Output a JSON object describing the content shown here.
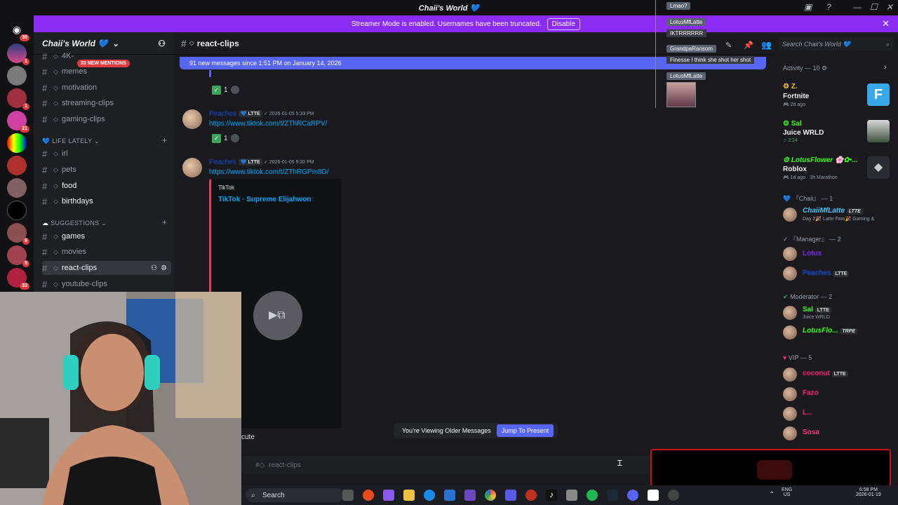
{
  "window": {
    "title": "Chaii's World 💙"
  },
  "banner": {
    "text": "Streamer Mode is enabled. Usernames have been truncated.",
    "disable_label": "Disable"
  },
  "rail": {
    "badges": [
      "30",
      "1",
      "1",
      "21",
      "6",
      "8",
      "5",
      "33"
    ]
  },
  "server": {
    "name": "Chaii's World 💙"
  },
  "mentions_pill": "33 NEW MENTIONS",
  "channels_top": [
    {
      "label": "4K-"
    },
    {
      "label": "memes"
    },
    {
      "label": "motivation"
    },
    {
      "label": "streaming-clips"
    },
    {
      "label": "gaming-clips"
    }
  ],
  "cat_life": "LIFE LATELY",
  "channels_life": [
    {
      "label": "irl"
    },
    {
      "label": "pets"
    },
    {
      "label": "food"
    },
    {
      "label": "birthdays"
    }
  ],
  "cat_sugg": "SUGGESTIONS",
  "channels_sugg": [
    {
      "label": "games"
    },
    {
      "label": "movies"
    },
    {
      "label": "react-clips"
    },
    {
      "label": "youtube-clips"
    }
  ],
  "chat": {
    "channel": "react-clips",
    "new_messages": "91 new messages since 1:51 PM on January 14, 2026",
    "messages": [
      {
        "author": "Peaches",
        "tag": "LTTE",
        "timestamp": "2026-01-05 5:33 PM",
        "link": "https://www.tiktok.com/t/ZThRCaRPV/",
        "reaction_count": "1"
      },
      {
        "author": "Peaches",
        "tag": "LTTE",
        "timestamp": "2026-01-05 9:30 PM",
        "link": "https://www.tiktok.com/t/ZThRGPm8D/"
      }
    ],
    "first_reaction_count": "1",
    "embed": {
      "provider": "TikTok",
      "title": "TikTok · Supreme Elijahwon"
    },
    "partial_text": "cute",
    "older_text": "You're Viewing Older Messages",
    "jump_label": "Jump To Present",
    "composer_placeholder": "react-clips"
  },
  "overlay": {
    "items": [
      {
        "name": "Lmao?"
      },
      {
        "name": "LotusMfLatte",
        "msg": "IKTRRRRRR"
      },
      {
        "name": "GrandpaRansom",
        "msg": "Finesse I think she shot her shot"
      },
      {
        "name": "LotusMfLatte"
      }
    ]
  },
  "members": {
    "search_placeholder": "Search Chaii's World 💙",
    "activity_header": "Activity — 10",
    "activities": [
      {
        "user": "Z.",
        "game": "Fortnite",
        "meta": "2d ago"
      },
      {
        "user": "Sal",
        "game": "Juice WRLD",
        "meta": "2:24"
      },
      {
        "user": "LotusFlower 🌸✿•...",
        "game": "Roblox",
        "meta": "1d ago · 3h Marathon"
      }
    ],
    "groups": [
      {
        "header": "『Chaii』 — 1",
        "entries": [
          {
            "name": "ChaiiMfLatte",
            "tag": "LTTE",
            "sub": "Day 2🎉 Latte Fam🎉 Gaming &",
            "color": "#4fc3f7"
          }
        ]
      },
      {
        "header": "『Manager』 — 2",
        "entries": [
          {
            "name": "Lotus",
            "tag": "",
            "sub": "",
            "color": "#7b2ff7"
          },
          {
            "name": "Peaches",
            "tag": "LTTE",
            "sub": "",
            "color": "#1d4ed8"
          }
        ]
      },
      {
        "header": "Moderator — 2",
        "entries": [
          {
            "name": "Sal",
            "tag": "LTTE",
            "sub": "Juice WRLD",
            "color": "#39ff14"
          },
          {
            "name": "LotusFlo...",
            "tag": "TRPE",
            "sub": "",
            "color": "#39ff14"
          }
        ]
      },
      {
        "header": "VIP — 5",
        "entries": [
          {
            "name": "coconut",
            "tag": "LTTE",
            "sub": "",
            "color": "#ff2d75"
          },
          {
            "name": "Fazo",
            "tag": "",
            "sub": "",
            "color": "#ff2d75"
          },
          {
            "name": "L...",
            "tag": "",
            "sub": "",
            "color": "#ff2d75"
          },
          {
            "name": "Sosa",
            "tag": "",
            "sub": "",
            "color": "#ff2d75"
          }
        ]
      }
    ]
  },
  "taskbar": {
    "search_label": "Search",
    "lang_top": "ENG",
    "lang_bottom": "US",
    "time": "6:58 PM",
    "date": "2026-01-19"
  },
  "colors": {
    "accent": "#5865f2",
    "banner": "#8b2cf5",
    "mention": "#e03a3e",
    "link": "#00a8fc"
  },
  "icons": [
    "discord-icon",
    "bell-icon",
    "help-icon",
    "search-icon",
    "pin-icon",
    "members-icon",
    "add-user-icon",
    "gear-icon",
    "chevron-right-icon",
    "close-icon"
  ]
}
